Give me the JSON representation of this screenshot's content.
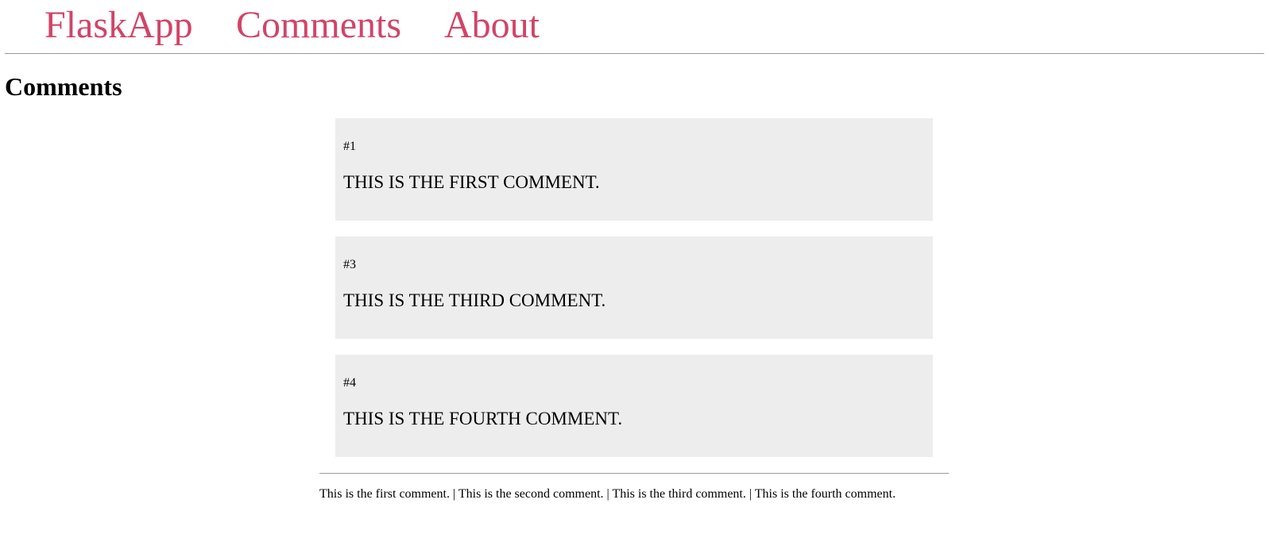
{
  "nav": {
    "brand": "FlaskApp",
    "comments_link": "Comments",
    "about_link": "About"
  },
  "page_title": "Comments",
  "comments": [
    {
      "id": "#1",
      "text": "THIS IS THE FIRST COMMENT."
    },
    {
      "id": "#3",
      "text": "THIS IS THE THIRD COMMENT."
    },
    {
      "id": "#4",
      "text": "THIS IS THE FOURTH COMMENT."
    }
  ],
  "footer": {
    "text": "This is the first comment. | This is the second comment. | This is the third comment. | This is the fourth comment."
  },
  "colors": {
    "link": "#d14468",
    "card_background": "#ededed",
    "rule": "#999999"
  }
}
